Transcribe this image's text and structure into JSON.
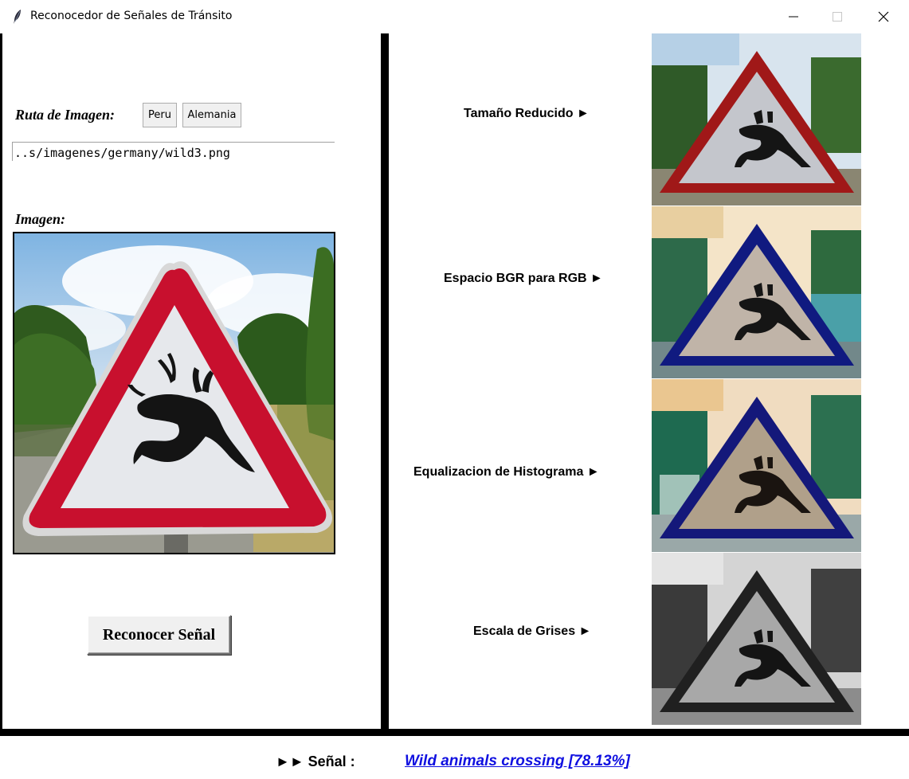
{
  "window": {
    "title": "Reconocedor de Señales de Tránsito",
    "controls": [
      "minimize-icon",
      "maximize-icon",
      "close-icon"
    ]
  },
  "left_panel": {
    "path_label": "Ruta de Imagen:",
    "buttons": {
      "peru": "Peru",
      "alemania": "Alemania"
    },
    "path_value": "..s/imagenes/germany/wild3.png",
    "image_label": "Imagen:",
    "recognize_button": "Reconocer Señal"
  },
  "right_panel": {
    "steps": [
      {
        "label": "Tamaño Reducido ►"
      },
      {
        "label": "Espacio BGR para RGB ►"
      },
      {
        "label": "Equalizacion de Histograma ►"
      },
      {
        "label": "Escala de Grises ►"
      }
    ]
  },
  "result": {
    "label": "►► Señal :",
    "value": "Wild animals crossing [78.13%]"
  },
  "colors": {
    "sign_border_red": "#c8102e",
    "sign_border_blue": "#0a1a8a",
    "result_link": "#1010e0"
  }
}
